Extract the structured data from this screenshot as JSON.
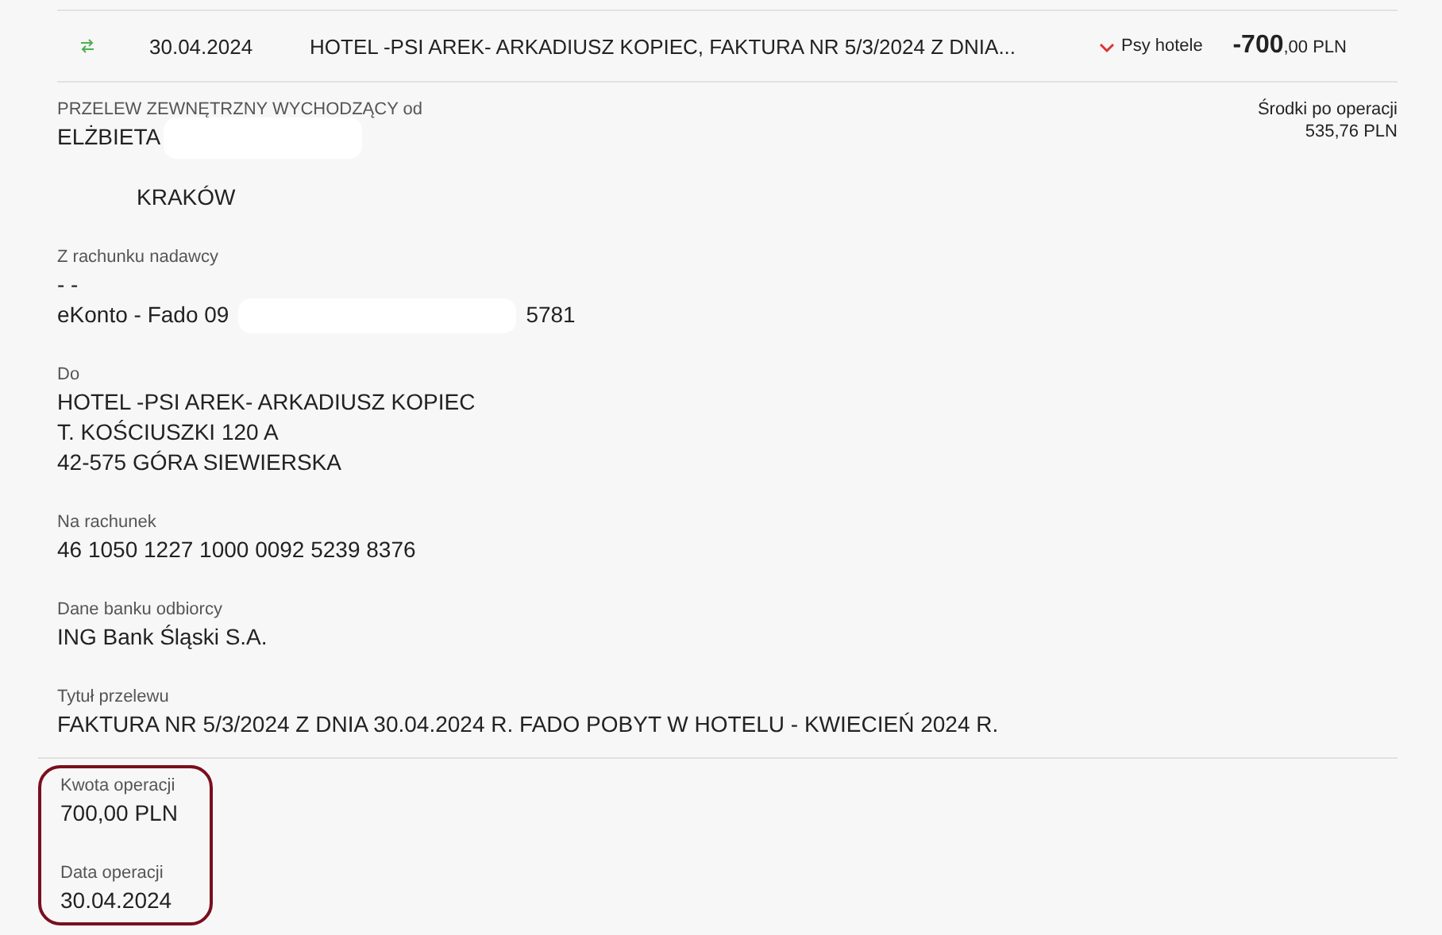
{
  "transaction": {
    "date": "30.04.2024",
    "title": "HOTEL -PSI AREK- ARKADIUSZ KOPIEC, FAKTURA NR 5/3/2024 Z DNIA...",
    "category": "Psy hotele",
    "amount_whole": "-700",
    "amount_rest": ",00 PLN",
    "expanded": true
  },
  "sender": {
    "label": "PRZELEW ZEWNĘTRZNY WYCHODZĄCY od",
    "name": "ELŻBIETA",
    "city": "KRAKÓW"
  },
  "balance": {
    "label": "Środki po operacji",
    "value": "535,76 PLN"
  },
  "account": {
    "label": "Z rachunku nadawcy",
    "line_1": "- -",
    "prefix": "eKonto - Fado 09",
    "suffix": "5781"
  },
  "sections": [
    {
      "label": "Do",
      "lines": [
        "HOTEL -PSI AREK- ARKADIUSZ KOPIEC",
        "T. KOŚCIUSZKI 120 A",
        "42-575 GÓRA SIEWIERSKA"
      ]
    },
    {
      "label": "Na rachunek",
      "lines": [
        "46 1050 1227 1000 0092 5239 8376"
      ]
    },
    {
      "label": "Dane banku odbiorcy",
      "lines": [
        "ING Bank Śląski S.A."
      ]
    },
    {
      "label": "Tytuł przelewu",
      "lines": [
        "FAKTURA NR 5/3/2024 Z DNIA 30.04.2024 R. FADO POBYT W HOTELU - KWIECIEŃ 2024 R."
      ]
    }
  ],
  "summary": {
    "highlighted": true,
    "items": [
      {
        "label": "Kwota operacji",
        "value": "700,00 PLN"
      },
      {
        "label": "Data operacji",
        "value": "30.04.2024"
      }
    ]
  }
}
